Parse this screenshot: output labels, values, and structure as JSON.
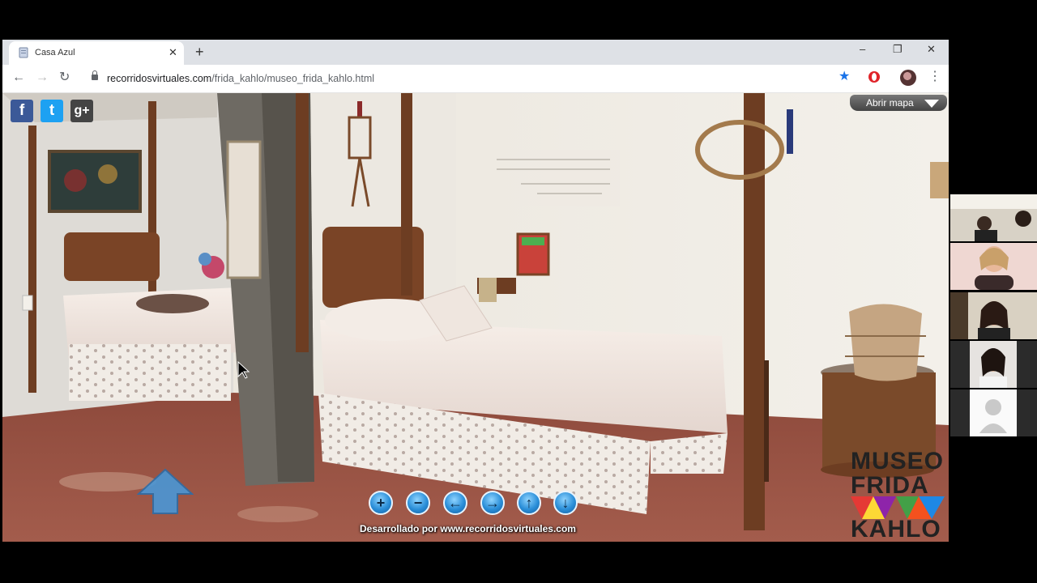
{
  "browser": {
    "tab_title": "Casa Azul",
    "tab_close": "✕",
    "new_tab": "+",
    "url_domain": "recorridosvirtuales.com",
    "url_path": "/frida_kahlo/museo_frida_kahlo.html",
    "nav": {
      "back": "←",
      "forward": "→",
      "reload": "↻"
    },
    "window": {
      "minimize": "–",
      "restore": "❐",
      "close": "✕"
    },
    "star": "★",
    "menu": "⋮"
  },
  "tour": {
    "social": {
      "facebook": "f",
      "twitter": "t",
      "googleplus": "g+"
    },
    "map_button": "Abrir mapa",
    "controls": [
      "+",
      "−",
      "←",
      "→",
      "↑",
      "↓"
    ],
    "credit": "Desarrollado por www.recorridosvirtuales.com",
    "logo_lines": [
      "MUSEO",
      "FRIDA",
      "KAHLO"
    ]
  },
  "colors": {
    "facebook": "#3b5998",
    "twitter": "#1da1f2",
    "googleplus": "#444444",
    "control_blue": "#2a8ed8",
    "map_button": "#555555"
  },
  "icons": {
    "favicon": "document-icon",
    "lock": "lock-icon",
    "star": "bookmark-star-icon",
    "opera": "opera-icon",
    "profile": "avatar-icon",
    "direction": "arrow-up-icon"
  }
}
